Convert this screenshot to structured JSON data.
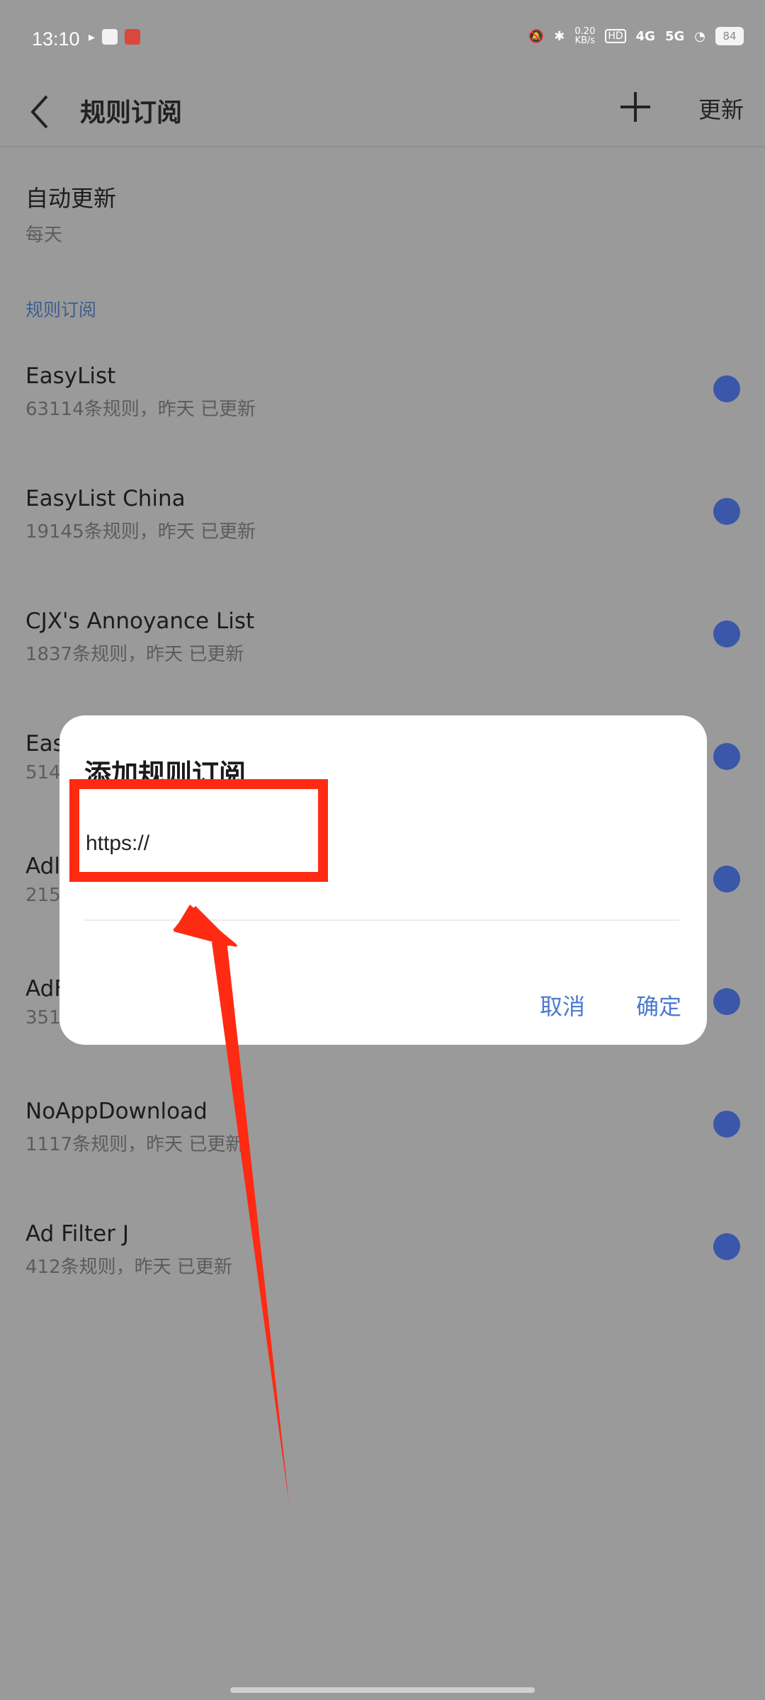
{
  "status_bar": {
    "time": "13:10",
    "net_speed": "0.20",
    "net_speed_unit": "KB/s",
    "signal_4g": "4G",
    "signal_5g": "5G",
    "battery": "84"
  },
  "header": {
    "title": "规则订阅",
    "update_label": "更新"
  },
  "auto_update": {
    "title": "自动更新",
    "value": "每天"
  },
  "section_label": "规则订阅",
  "subscriptions": [
    {
      "name": "EasyList",
      "meta": "63114条规则，昨天 已更新"
    },
    {
      "name": "EasyList China",
      "meta": "19145条规则，昨天 已更新"
    },
    {
      "name": "CJX's Annoyance List",
      "meta": "1837条规则，昨天 已更新"
    },
    {
      "name": "Eas",
      "meta": "514"
    },
    {
      "name": "Adl",
      "meta": "215"
    },
    {
      "name": "AdF",
      "meta": "351"
    },
    {
      "name": "NoAppDownload",
      "meta": "1117条规则，昨天 已更新"
    },
    {
      "name": "Ad Filter J",
      "meta": "412条规则，昨天 已更新"
    }
  ],
  "dialog": {
    "title": "添加规则订阅",
    "input_value": "https://",
    "cancel_label": "取消",
    "ok_label": "确定"
  },
  "colors": {
    "accent": "#4b7ad0",
    "toggle": "#3a57a9",
    "annotation": "#ff2a12",
    "scrim": "#9a9a9a"
  }
}
